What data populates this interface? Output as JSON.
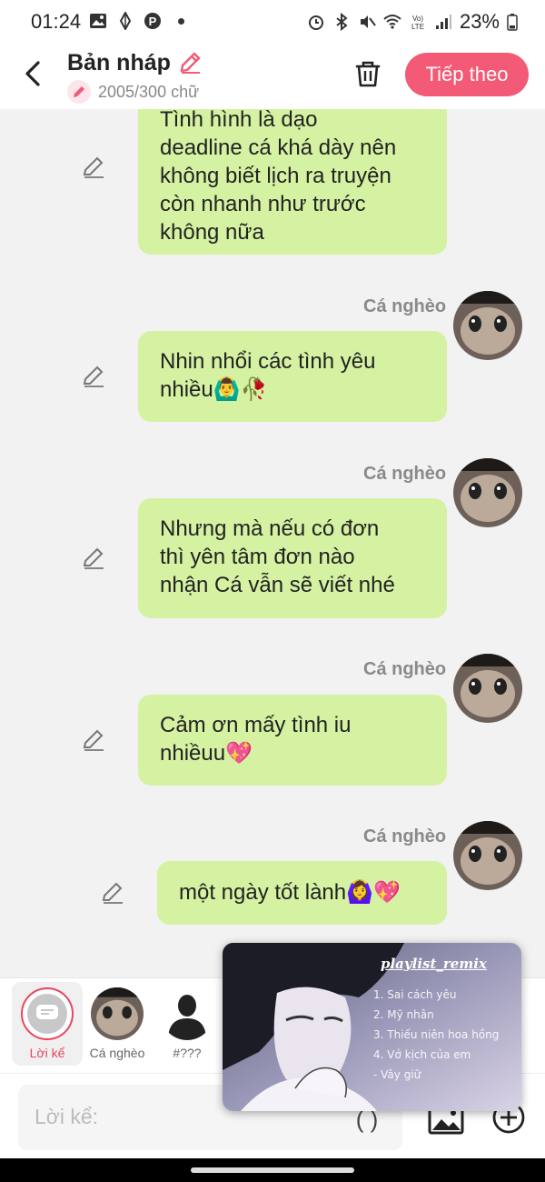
{
  "status_bar": {
    "time": "01:24",
    "battery": "23%"
  },
  "header": {
    "title": "Bản nháp",
    "counter": "2005/300 chữ",
    "next_label": "Tiếp theo"
  },
  "messages": [
    {
      "sender": "",
      "lines": [
        "Tình hình là dạo",
        "deadline cá khá dày nên",
        "không biết lịch ra truyện",
        "còn nhanh như trước",
        "không nữa"
      ]
    },
    {
      "sender": "Cá nghèo",
      "lines": [
        "Nhin nhổi các tình yêu",
        "nhiều🙆‍♂️🥀"
      ]
    },
    {
      "sender": "Cá nghèo",
      "lines": [
        "Nhưng mà nếu có đơn",
        "thì yên tâm đơn nào",
        "nhận Cá vẫn sẽ viết nhé"
      ]
    },
    {
      "sender": "Cá nghèo",
      "lines": [
        "Cảm ơn mấy tình iu",
        "nhiềuu💖"
      ]
    },
    {
      "sender": "Cá nghèo",
      "lines": [
        "một ngày tốt lành🙆‍♀️💖"
      ]
    }
  ],
  "characters": [
    {
      "label": "Lời kể",
      "active": true
    },
    {
      "label": "Cá nghèo",
      "active": false
    },
    {
      "label": "#???",
      "active": false
    }
  ],
  "input": {
    "placeholder": "Lời kể:",
    "paren_label": "( )"
  },
  "overlay": {
    "title": "playlist_remix",
    "items": [
      "1. Sai cách yêu",
      "2. Mỹ nhân",
      "3. Thiếu niên hoa hồng",
      "4. Vở kịch của em",
      "- Vây giữ"
    ]
  },
  "colors": {
    "accent": "#f25a75",
    "bubble": "#d5f2a3",
    "background": "#f2f2f2"
  }
}
